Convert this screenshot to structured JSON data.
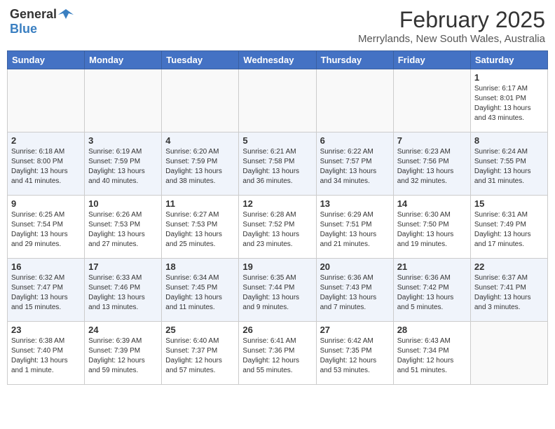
{
  "header": {
    "logo_general": "General",
    "logo_blue": "Blue",
    "month": "February 2025",
    "location": "Merrylands, New South Wales, Australia"
  },
  "weekdays": [
    "Sunday",
    "Monday",
    "Tuesday",
    "Wednesday",
    "Thursday",
    "Friday",
    "Saturday"
  ],
  "weeks": [
    [
      {
        "day": "",
        "info": ""
      },
      {
        "day": "",
        "info": ""
      },
      {
        "day": "",
        "info": ""
      },
      {
        "day": "",
        "info": ""
      },
      {
        "day": "",
        "info": ""
      },
      {
        "day": "",
        "info": ""
      },
      {
        "day": "1",
        "info": "Sunrise: 6:17 AM\nSunset: 8:01 PM\nDaylight: 13 hours\nand 43 minutes."
      }
    ],
    [
      {
        "day": "2",
        "info": "Sunrise: 6:18 AM\nSunset: 8:00 PM\nDaylight: 13 hours\nand 41 minutes."
      },
      {
        "day": "3",
        "info": "Sunrise: 6:19 AM\nSunset: 7:59 PM\nDaylight: 13 hours\nand 40 minutes."
      },
      {
        "day": "4",
        "info": "Sunrise: 6:20 AM\nSunset: 7:59 PM\nDaylight: 13 hours\nand 38 minutes."
      },
      {
        "day": "5",
        "info": "Sunrise: 6:21 AM\nSunset: 7:58 PM\nDaylight: 13 hours\nand 36 minutes."
      },
      {
        "day": "6",
        "info": "Sunrise: 6:22 AM\nSunset: 7:57 PM\nDaylight: 13 hours\nand 34 minutes."
      },
      {
        "day": "7",
        "info": "Sunrise: 6:23 AM\nSunset: 7:56 PM\nDaylight: 13 hours\nand 32 minutes."
      },
      {
        "day": "8",
        "info": "Sunrise: 6:24 AM\nSunset: 7:55 PM\nDaylight: 13 hours\nand 31 minutes."
      }
    ],
    [
      {
        "day": "9",
        "info": "Sunrise: 6:25 AM\nSunset: 7:54 PM\nDaylight: 13 hours\nand 29 minutes."
      },
      {
        "day": "10",
        "info": "Sunrise: 6:26 AM\nSunset: 7:53 PM\nDaylight: 13 hours\nand 27 minutes."
      },
      {
        "day": "11",
        "info": "Sunrise: 6:27 AM\nSunset: 7:53 PM\nDaylight: 13 hours\nand 25 minutes."
      },
      {
        "day": "12",
        "info": "Sunrise: 6:28 AM\nSunset: 7:52 PM\nDaylight: 13 hours\nand 23 minutes."
      },
      {
        "day": "13",
        "info": "Sunrise: 6:29 AM\nSunset: 7:51 PM\nDaylight: 13 hours\nand 21 minutes."
      },
      {
        "day": "14",
        "info": "Sunrise: 6:30 AM\nSunset: 7:50 PM\nDaylight: 13 hours\nand 19 minutes."
      },
      {
        "day": "15",
        "info": "Sunrise: 6:31 AM\nSunset: 7:49 PM\nDaylight: 13 hours\nand 17 minutes."
      }
    ],
    [
      {
        "day": "16",
        "info": "Sunrise: 6:32 AM\nSunset: 7:47 PM\nDaylight: 13 hours\nand 15 minutes."
      },
      {
        "day": "17",
        "info": "Sunrise: 6:33 AM\nSunset: 7:46 PM\nDaylight: 13 hours\nand 13 minutes."
      },
      {
        "day": "18",
        "info": "Sunrise: 6:34 AM\nSunset: 7:45 PM\nDaylight: 13 hours\nand 11 minutes."
      },
      {
        "day": "19",
        "info": "Sunrise: 6:35 AM\nSunset: 7:44 PM\nDaylight: 13 hours\nand 9 minutes."
      },
      {
        "day": "20",
        "info": "Sunrise: 6:36 AM\nSunset: 7:43 PM\nDaylight: 13 hours\nand 7 minutes."
      },
      {
        "day": "21",
        "info": "Sunrise: 6:36 AM\nSunset: 7:42 PM\nDaylight: 13 hours\nand 5 minutes."
      },
      {
        "day": "22",
        "info": "Sunrise: 6:37 AM\nSunset: 7:41 PM\nDaylight: 13 hours\nand 3 minutes."
      }
    ],
    [
      {
        "day": "23",
        "info": "Sunrise: 6:38 AM\nSunset: 7:40 PM\nDaylight: 13 hours\nand 1 minute."
      },
      {
        "day": "24",
        "info": "Sunrise: 6:39 AM\nSunset: 7:39 PM\nDaylight: 12 hours\nand 59 minutes."
      },
      {
        "day": "25",
        "info": "Sunrise: 6:40 AM\nSunset: 7:37 PM\nDaylight: 12 hours\nand 57 minutes."
      },
      {
        "day": "26",
        "info": "Sunrise: 6:41 AM\nSunset: 7:36 PM\nDaylight: 12 hours\nand 55 minutes."
      },
      {
        "day": "27",
        "info": "Sunrise: 6:42 AM\nSunset: 7:35 PM\nDaylight: 12 hours\nand 53 minutes."
      },
      {
        "day": "28",
        "info": "Sunrise: 6:43 AM\nSunset: 7:34 PM\nDaylight: 12 hours\nand 51 minutes."
      },
      {
        "day": "",
        "info": ""
      }
    ]
  ]
}
